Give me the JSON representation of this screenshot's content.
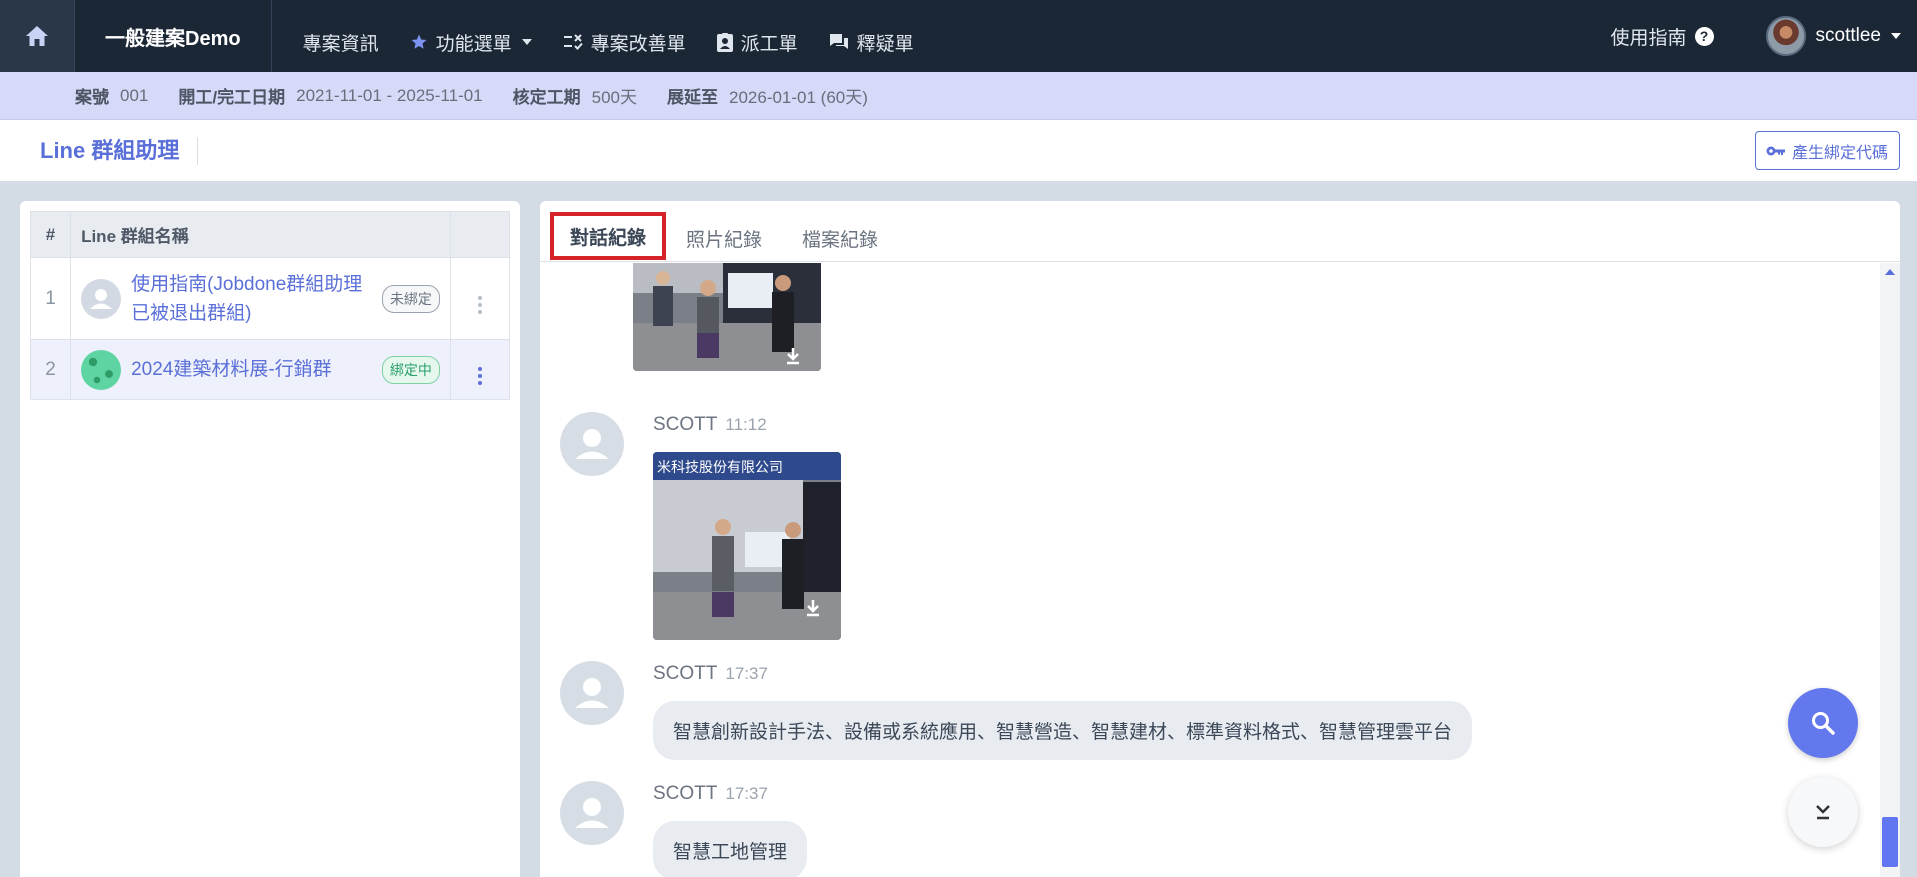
{
  "nav": {
    "brand": "一般建案Demo",
    "items": [
      {
        "label": "專案資訊",
        "icon": "none"
      },
      {
        "label": "功能選單",
        "icon": "star-icon"
      },
      {
        "label": "專案改善單",
        "icon": "checklist-icon"
      },
      {
        "label": "派工單",
        "icon": "id-badge-icon"
      },
      {
        "label": "釋疑單",
        "icon": "chat-icon"
      }
    ],
    "guide_label": "使用指南",
    "username": "scottlee"
  },
  "project_info": {
    "case_no_label": "案號",
    "case_no": "001",
    "dates_label": "開工/完工日期",
    "dates": "2021-11-01 - 2025-11-01",
    "approved_label": "核定工期",
    "approved": "500天",
    "extended_label": "展延至",
    "extended": "2026-01-01 (60天)"
  },
  "page": {
    "title": "Line 群組助理",
    "bind_code_button": "產生綁定代碼"
  },
  "groups_table": {
    "headers": [
      "#",
      "Line 群組名稱",
      ""
    ],
    "rows": [
      {
        "num": "1",
        "name": "使用指南(Jobdone群組助理已被退出群組)",
        "status": "未綁定"
      },
      {
        "num": "2",
        "name": "2024建築材料展-行銷群",
        "status": "綁定中"
      }
    ]
  },
  "tabs": [
    "對話紀錄",
    "照片紀錄",
    "檔案紀錄"
  ],
  "messages": [
    {
      "sender": "SCOTT",
      "time": "11:12",
      "type": "image"
    },
    {
      "sender": "SCOTT",
      "time": "17:37",
      "type": "text",
      "text": "智慧創新設計手法、設備或系統應用、智慧營造、智慧建材、標準資料格式、智慧管理雲平台"
    },
    {
      "sender": "SCOTT",
      "time": "17:37",
      "type": "text",
      "text": "智慧工地管理"
    }
  ],
  "photo_caption": "米科技股份有限公司",
  "colors": {
    "navbar": "#1c2736",
    "accent": "#5a6fd8",
    "active_tab_outline": "#d42427",
    "bound_green": "#27a069",
    "fab": "#6378ec"
  }
}
